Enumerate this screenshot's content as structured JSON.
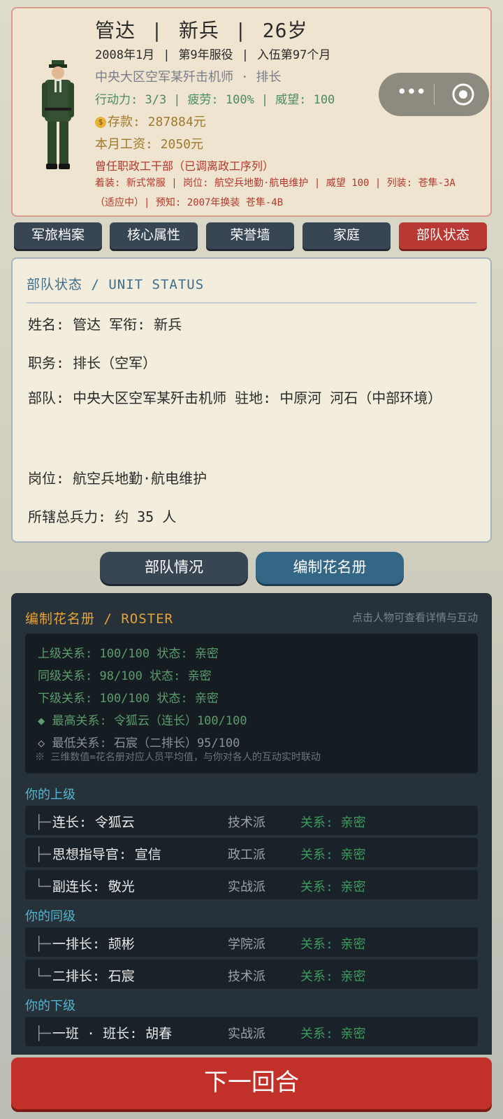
{
  "profile": {
    "name": "管达",
    "rank": "新兵",
    "age": "26岁",
    "date": "2008年1月",
    "service_year": "第9年服役",
    "enlist_month": "入伍第97个月",
    "unit_line": "中央大区空军某歼击机师 · 排长",
    "action": "行动力: 3/3",
    "fatigue": "疲劳: 100%",
    "prestige": "威望: 100",
    "savings": "存款: 287884元",
    "salary": "本月工资: 2050元",
    "former": "曾任职政工干部（已调离政工序列）",
    "equipment": "着装: 新式常服 | 岗位: 航空兵地勤·航电维护 | 威望 100 | 列装: 苍隼-3A（适应中）| 预知: 2007年换装 苍隼-4B",
    "separator": "|"
  },
  "capsule": {
    "more_icon": "more-dots-icon",
    "close_icon": "target-circle-icon"
  },
  "tabs": [
    {
      "label": "军旅档案"
    },
    {
      "label": "核心属性"
    },
    {
      "label": "荣誉墙"
    },
    {
      "label": "家庭"
    },
    {
      "label": "部队状态"
    }
  ],
  "active_tab": "部队状态",
  "status": {
    "title": "部队状态 / UNIT STATUS",
    "name_rank": "姓名: 管达   军衔: 新兵",
    "position": "职务: 排长（空军）",
    "unit_station": "部队: 中央大区空军某歼击机师  驻地: 中原河 河石（中部环境）",
    "post": "岗位: 航空兵地勤·航电维护",
    "troops": "所辖总兵力: 约 35 人"
  },
  "subtabs": [
    {
      "label": "部队情况"
    },
    {
      "label": "编制花名册"
    }
  ],
  "roster": {
    "title": "编制花名册 / ROSTER",
    "hint": "点击人物可查看详情与互动",
    "relations": {
      "superior": "上级关系: 100/100  状态: 亲密",
      "peer": "同级关系: 98/100  状态: 亲密",
      "subordinate": "下级关系: 100/100  状态: 亲密",
      "highest": "◆ 最高关系: 令狐云（连长）100/100",
      "lowest": "◇ 最低关系: 石宸（二排长）95/100",
      "note": "※ 三维数值=花名册对应人员平均值，与你对各人的互动实时联动"
    },
    "groups": [
      {
        "label": "你的上级",
        "members": [
          {
            "branch": "├─",
            "name": "连长: 令狐云",
            "faction": "技术派",
            "relation": "关系: 亲密"
          },
          {
            "branch": "├─",
            "name": "思想指导官: 宣信",
            "faction": "政工派",
            "relation": "关系: 亲密"
          },
          {
            "branch": "└─",
            "name": "副连长: 敬光",
            "faction": "实战派",
            "relation": "关系: 亲密"
          }
        ]
      },
      {
        "label": "你的同级",
        "members": [
          {
            "branch": "├─",
            "name": "一排长: 颉彬",
            "faction": "学院派",
            "relation": "关系: 亲密"
          },
          {
            "branch": "└─",
            "name": "二排长: 石宸",
            "faction": "技术派",
            "relation": "关系: 亲密"
          }
        ]
      },
      {
        "label": "你的下级",
        "members": [
          {
            "branch": "├─",
            "name": "一班 · 班长: 胡春",
            "faction": "实战派",
            "relation": "关系: 亲密"
          }
        ]
      }
    ]
  },
  "next_button": "下一回合",
  "colors": {
    "accent_red": "#c2302a",
    "active_blue": "#346785",
    "dark_panel": "#26313a"
  }
}
